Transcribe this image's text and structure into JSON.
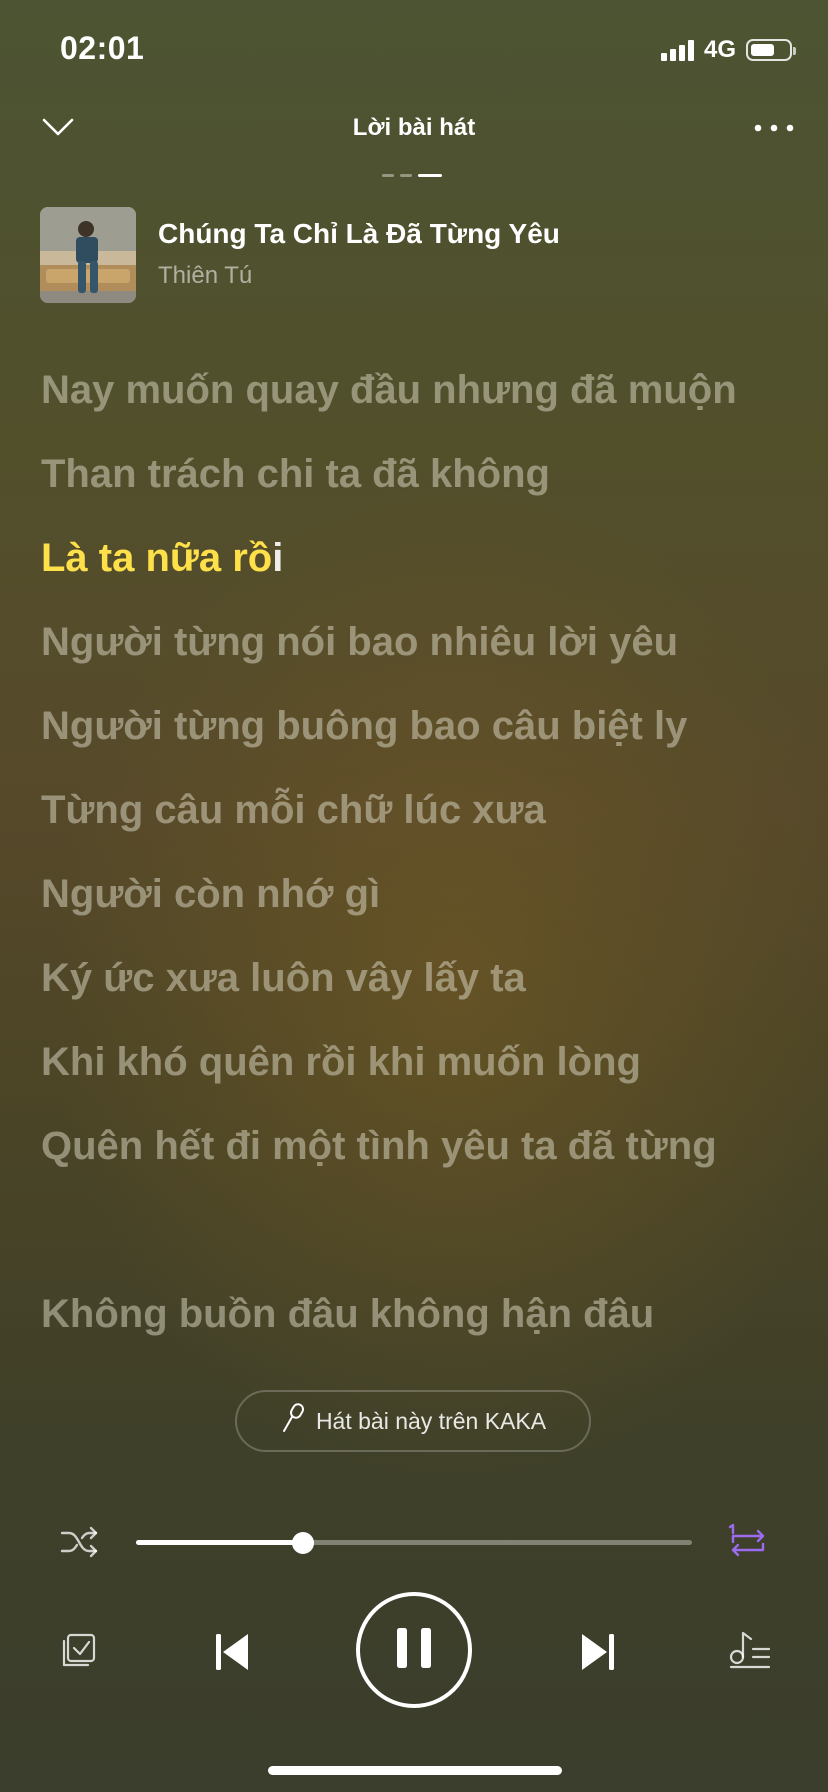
{
  "status_bar": {
    "time": "02:01",
    "network": "4G"
  },
  "header": {
    "title": "Lời bài hát"
  },
  "song": {
    "title": "Chúng Ta Chỉ Là Đã Từng Yêu",
    "artist": "Thiên Tú"
  },
  "lyrics": {
    "line_1": "Nay muốn quay đầu nhưng đã muộn",
    "line_2": "Than trách chi ta đã không",
    "active_sung": "Là ta nữa rồ",
    "active_rest": "i",
    "line_4": "Người từng nói bao nhiêu lời yêu",
    "line_5": "Người từng buông bao câu biệt ly",
    "line_6": "Từng câu mỗi chữ lúc xưa",
    "line_7": "Người còn nhớ gì",
    "line_8": "Ký ức xưa luôn vây lấy ta",
    "line_9": "Khi khó quên rồi khi muốn lòng",
    "line_10": "Quên hết đi một tình yêu ta đã từng",
    "line_11": "Không buồn đâu không hận đâu"
  },
  "karaoke": {
    "label": "Hát bài này trên KAKA"
  },
  "player": {
    "progress_fraction": 0.3,
    "repeat_color": "#9b6cf0",
    "active_lyric_color": "#fde04a"
  },
  "icons": {
    "collapse": "chevron-down-icon",
    "more": "more-icon",
    "mic": "mic-icon",
    "shuffle": "shuffle-icon",
    "repeat": "repeat-icon",
    "add_playlist": "add-to-playlist-icon",
    "previous": "previous-icon",
    "pause": "pause-icon",
    "next": "next-icon",
    "queue": "queue-icon"
  }
}
